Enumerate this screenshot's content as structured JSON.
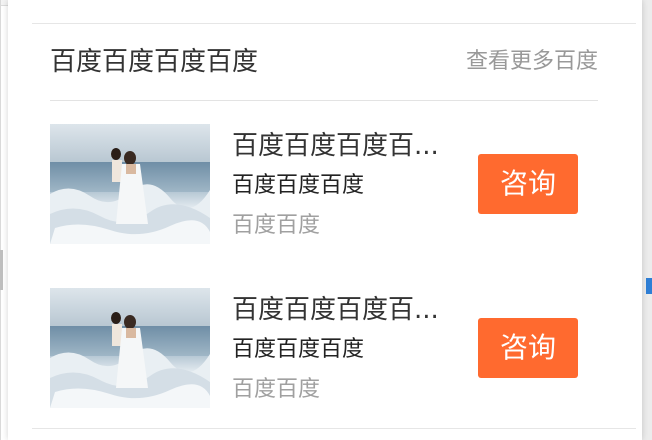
{
  "header": {
    "title": "百度百度百度百度",
    "more_link": "查看更多百度"
  },
  "items": [
    {
      "title": "百度百度百度百度百度",
      "subtitle": "百度百度百度",
      "meta": "百度百度",
      "button": "咨询"
    },
    {
      "title": "百度百度百度百度百度",
      "subtitle": "百度百度百度",
      "meta": "百度百度",
      "button": "咨询"
    }
  ],
  "colors": {
    "accent": "#ff6a2f",
    "text_primary": "#333333",
    "text_secondary": "#999999"
  }
}
